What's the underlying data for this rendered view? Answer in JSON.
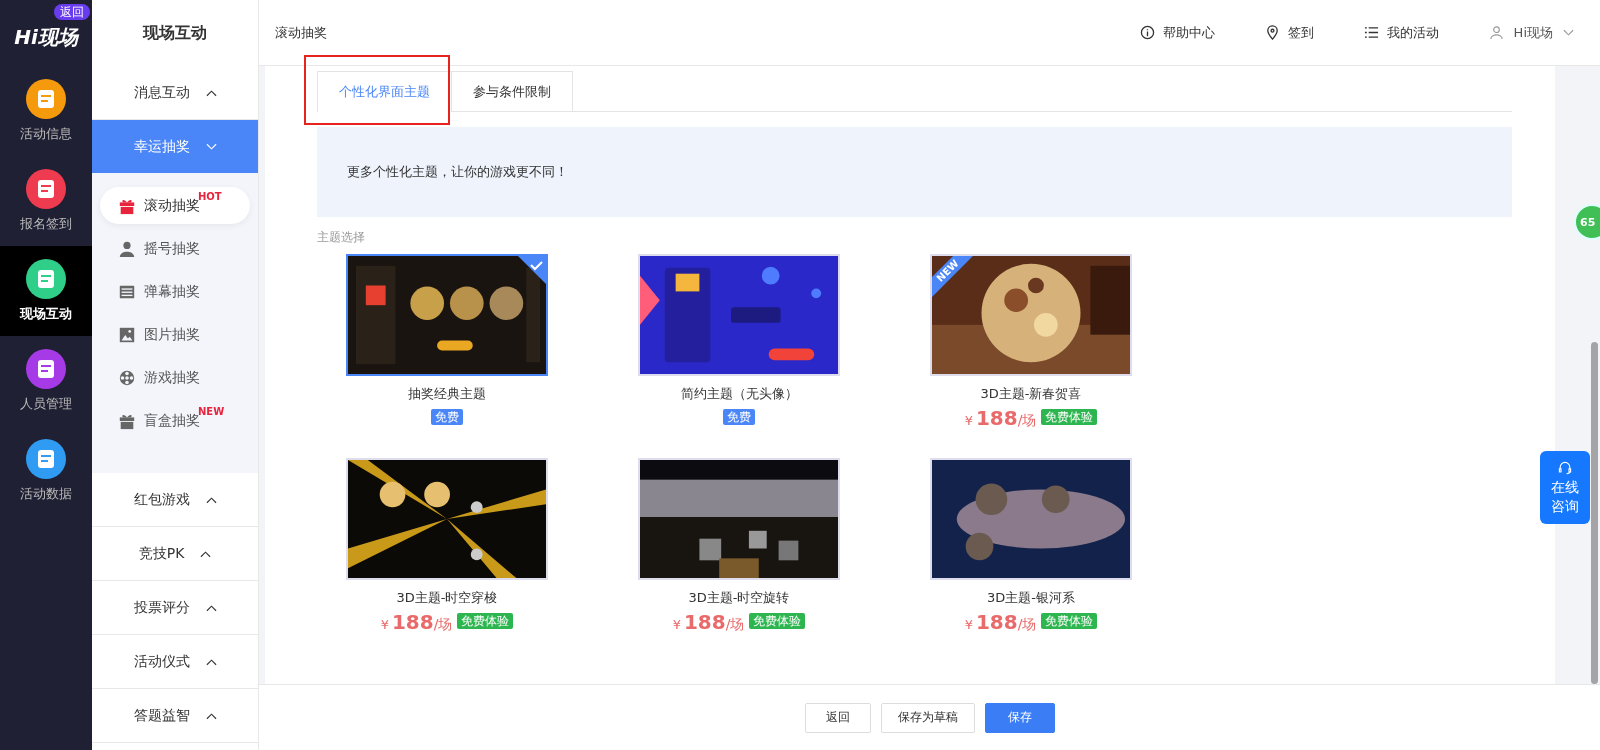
{
  "rail": {
    "logo": "Hi现场",
    "back_badge": "返回",
    "items": [
      {
        "label": "活动信息",
        "selected": false
      },
      {
        "label": "报名签到",
        "selected": false
      },
      {
        "label": "现场互动",
        "selected": true
      },
      {
        "label": "人员管理",
        "selected": false
      },
      {
        "label": "活动数据",
        "selected": false
      }
    ]
  },
  "sidebar": {
    "title": "现场互动",
    "groups": [
      {
        "label": "消息互动",
        "expanded": false,
        "selected": false
      },
      {
        "label": "幸运抽奖",
        "expanded": true,
        "selected": true,
        "children": [
          {
            "label": "滚动抽奖",
            "badge": "HOT",
            "selected": true
          },
          {
            "label": "摇号抽奖",
            "selected": false
          },
          {
            "label": "弹幕抽奖",
            "selected": false
          },
          {
            "label": "图片抽奖",
            "selected": false
          },
          {
            "label": "游戏抽奖",
            "selected": false
          },
          {
            "label": "盲盒抽奖",
            "badge": "NEW",
            "selected": false
          }
        ]
      },
      {
        "label": "红包游戏",
        "expanded": false,
        "selected": false
      },
      {
        "label": "竞技PK",
        "expanded": false,
        "selected": false
      },
      {
        "label": "投票评分",
        "expanded": false,
        "selected": false
      },
      {
        "label": "活动仪式",
        "expanded": false,
        "selected": false
      },
      {
        "label": "答题益智",
        "expanded": false,
        "selected": false
      }
    ]
  },
  "header": {
    "breadcrumb": "滚动抽奖",
    "links": [
      "帮助中心",
      "签到",
      "我的活动"
    ],
    "user": "Hi现场"
  },
  "tabs": [
    {
      "label": "个性化界面主题",
      "selected": true,
      "highlighted": true
    },
    {
      "label": "参与条件限制",
      "selected": false,
      "highlighted": false
    }
  ],
  "banner": "更多个性化主题，让你的游戏更不同！",
  "section_label": "主题选择",
  "themes": [
    {
      "title": "抽奖经典主题",
      "badge": "免费",
      "kind": "free",
      "selected": true
    },
    {
      "title": "简约主题（无头像）",
      "badge": "免费",
      "kind": "free",
      "selected": false
    },
    {
      "title": "3D主题-新春贺喜",
      "currency": "¥",
      "price": "188",
      "unit": "/场",
      "badge": "免费体验",
      "kind": "trial",
      "ribbon": "NEW",
      "selected": false
    },
    {
      "title": "3D主题-时空穿梭",
      "currency": "¥",
      "price": "188",
      "unit": "/场",
      "badge": "免费体验",
      "kind": "trial",
      "selected": false
    },
    {
      "title": "3D主题-时空旋转",
      "currency": "¥",
      "price": "188",
      "unit": "/场",
      "badge": "免费体验",
      "kind": "trial",
      "selected": false
    },
    {
      "title": "3D主题-银河系",
      "currency": "¥",
      "price": "188",
      "unit": "/场",
      "badge": "免费体验",
      "kind": "trial",
      "selected": false
    }
  ],
  "footer_buttons": [
    {
      "label": "返回",
      "kind": "default"
    },
    {
      "label": "保存为草稿",
      "kind": "default"
    },
    {
      "label": "保存",
      "kind": "primary"
    }
  ],
  "float_consult": "在线咨询",
  "float_badge": "65"
}
